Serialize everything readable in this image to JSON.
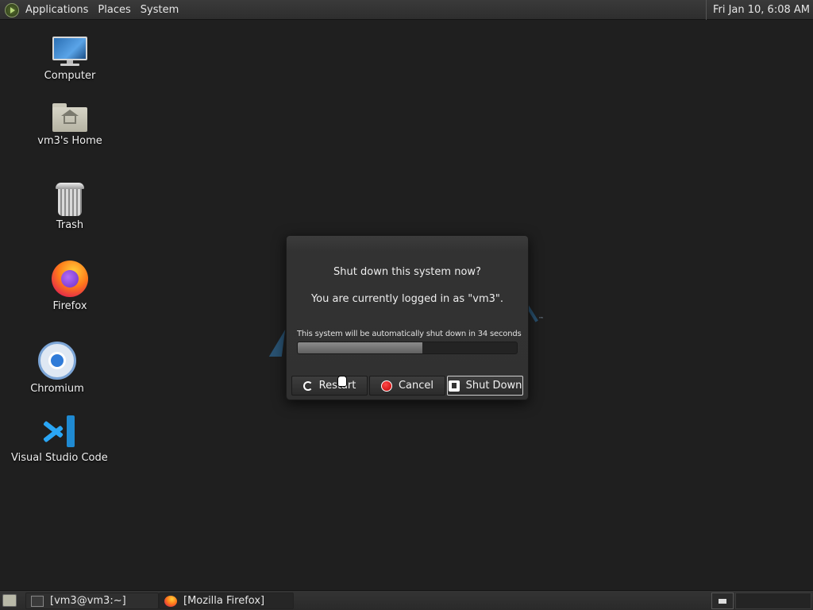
{
  "top_panel": {
    "menu": [
      "Applications",
      "Places",
      "System"
    ],
    "clock": "Fri Jan 10,  6:08 AM"
  },
  "desktop_icons": [
    {
      "label": "Computer",
      "icon": "computer-icon"
    },
    {
      "label": "vm3's Home",
      "icon": "home-folder-icon"
    },
    {
      "label": "Trash",
      "icon": "trash-icon"
    },
    {
      "label": "Firefox",
      "icon": "firefox-icon"
    },
    {
      "label": "Chromium",
      "icon": "chromium-icon"
    },
    {
      "label": "Visual Studio Code",
      "icon": "vscode-icon"
    }
  ],
  "dialog": {
    "title": "Shut down this system now?",
    "subtitle": "You are currently logged in as \"vm3\".",
    "countdown": "This system will be automatically shut down in 34 seconds",
    "progress_fraction": 0.57,
    "buttons": {
      "restart": "Restart",
      "cancel": "Cancel",
      "shutdown": "Shut Down"
    }
  },
  "bottom_panel": {
    "tasks": [
      "[vm3@vm3:~]",
      "[Mozilla Firefox]"
    ]
  },
  "colors": {
    "desktop_bg": "#1f1f1f",
    "dialog_bg": "#323232",
    "cancel_red": "#d00000"
  }
}
